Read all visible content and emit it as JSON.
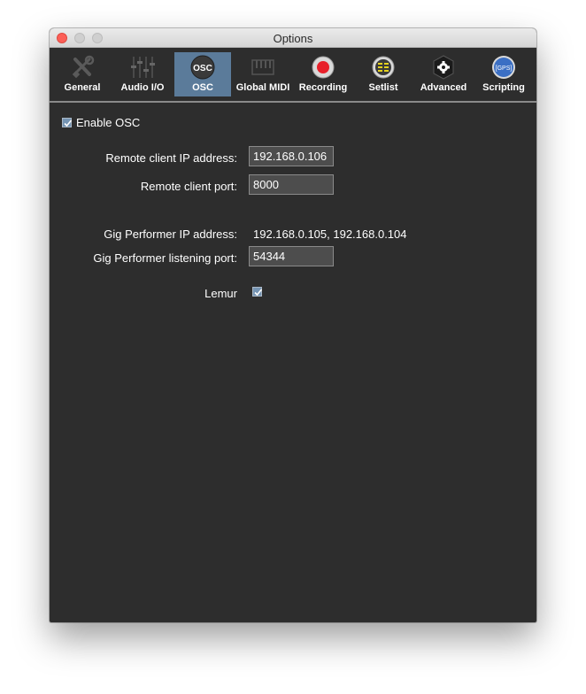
{
  "window": {
    "title": "Options"
  },
  "toolbar": {
    "tabs": [
      {
        "label": "General",
        "icon": "tools-icon"
      },
      {
        "label": "Audio I/O",
        "icon": "mixer-sliders-icon"
      },
      {
        "label": "OSC",
        "icon": "osc-icon",
        "icon_text": "OSC",
        "selected": true
      },
      {
        "label": "Global MIDI",
        "icon": "midi-keyboard-icon"
      },
      {
        "label": "Recording",
        "icon": "record-icon"
      },
      {
        "label": "Setlist",
        "icon": "setlist-icon"
      },
      {
        "label": "Advanced",
        "icon": "gear-shield-icon"
      },
      {
        "label": "Scripting",
        "icon": "gps-icon",
        "icon_text": "[GPS]"
      }
    ]
  },
  "osc": {
    "enable_label": "Enable OSC",
    "enable_checked": true,
    "remote_ip_label": "Remote client IP address:",
    "remote_ip_value": "192.168.0.106",
    "remote_port_label": "Remote client port:",
    "remote_port_value": "8000",
    "gp_ip_label": "Gig Performer IP address:",
    "gp_ip_value": "192.168.0.105, 192.168.0.104",
    "gp_port_label": "Gig Performer listening port:",
    "gp_port_value": "54344",
    "lemur_label": "Lemur",
    "lemur_checked": true
  },
  "colors": {
    "background": "#2d2d2d",
    "selected_tab": "#5b7b9a",
    "record_red": "#e8202a",
    "setlist_yellow": "#e6d21e",
    "scripting_blue": "#3b6fc4"
  }
}
